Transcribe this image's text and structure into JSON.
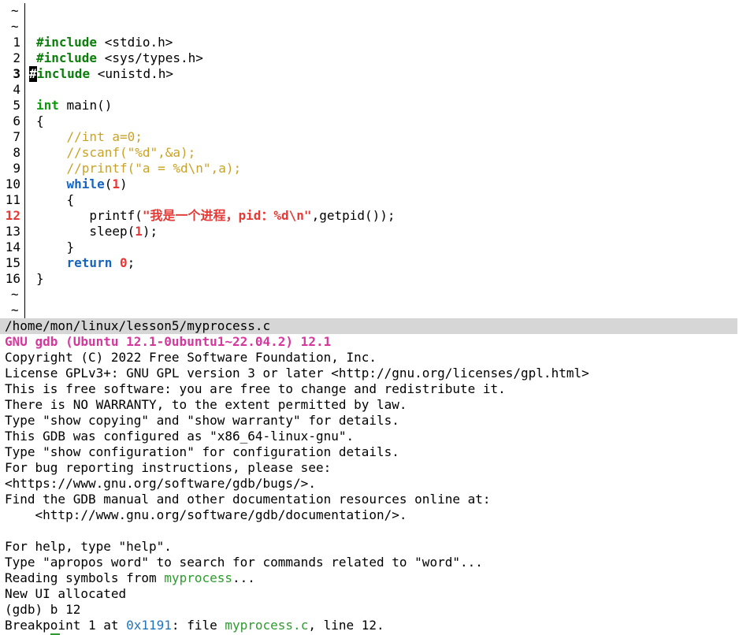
{
  "editor": {
    "empty_marker": "~",
    "lines": [
      {
        "num": "1",
        "parts": [
          [
            "#include",
            "kw-pre"
          ],
          [
            " <stdio.h>",
            ""
          ]
        ]
      },
      {
        "num": "2",
        "parts": [
          [
            "#include",
            "kw-pre"
          ],
          [
            " <sys/types.h>",
            ""
          ]
        ]
      },
      {
        "num": "3",
        "parts": [
          [
            "#include",
            "kw-pre"
          ],
          [
            " <unistd.h>",
            ""
          ]
        ],
        "current": true
      },
      {
        "num": "4",
        "parts": []
      },
      {
        "num": "5",
        "parts": [
          [
            "int",
            "kw-type"
          ],
          [
            " main()",
            ""
          ]
        ]
      },
      {
        "num": "6",
        "parts": [
          [
            "{",
            ""
          ]
        ]
      },
      {
        "num": "7",
        "parts": [
          [
            "    ",
            ""
          ],
          [
            "//int a=0;",
            "cmt"
          ]
        ]
      },
      {
        "num": "8",
        "parts": [
          [
            "    ",
            ""
          ],
          [
            "//scanf(\"%d\",&a);",
            "cmt"
          ]
        ]
      },
      {
        "num": "9",
        "parts": [
          [
            "    ",
            ""
          ],
          [
            "//printf(\"a = %d\\n\",a);",
            "cmt"
          ]
        ]
      },
      {
        "num": "10",
        "parts": [
          [
            "    ",
            ""
          ],
          [
            "while",
            "kw-ctl"
          ],
          [
            "(",
            ""
          ],
          [
            "1",
            "num"
          ],
          [
            ")",
            ""
          ]
        ]
      },
      {
        "num": "11",
        "parts": [
          [
            "    {",
            ""
          ]
        ]
      },
      {
        "num": "12",
        "parts": [
          [
            "       printf(",
            ""
          ],
          [
            "\"我是一个进程，pid：%d\\n\"",
            "str"
          ],
          [
            ",getpid());",
            ""
          ]
        ],
        "breakpoint": true
      },
      {
        "num": "13",
        "parts": [
          [
            "       sleep(",
            ""
          ],
          [
            "1",
            "num"
          ],
          [
            ");",
            ""
          ]
        ]
      },
      {
        "num": "14",
        "parts": [
          [
            "    }",
            ""
          ]
        ]
      },
      {
        "num": "15",
        "parts": [
          [
            "    ",
            ""
          ],
          [
            "return",
            "kw-ctl"
          ],
          [
            " ",
            ""
          ],
          [
            "0",
            "num"
          ],
          [
            ";",
            ""
          ]
        ]
      },
      {
        "num": "16",
        "parts": [
          [
            "}",
            ""
          ]
        ]
      }
    ]
  },
  "status_bar": {
    "file_path": "/home/mon/linux/lesson5/myprocess.c"
  },
  "gdb": {
    "lines": [
      [
        [
          "GNU gdb (Ubuntu 12.1-0ubuntu1~22.04.2) 12.1",
          "gdb-title"
        ]
      ],
      [
        [
          "Copyright (C) 2022 Free Software Foundation, Inc.",
          ""
        ]
      ],
      [
        [
          "License GPLv3+: GNU GPL version 3 or later <http://gnu.org/licenses/gpl.html>",
          ""
        ]
      ],
      [
        [
          "This is free software: you are free to change and redistribute it.",
          ""
        ]
      ],
      [
        [
          "There is NO WARRANTY, to the extent permitted by law.",
          ""
        ]
      ],
      [
        [
          "Type \"show copying\" and \"show warranty\" for details.",
          ""
        ]
      ],
      [
        [
          "This GDB was configured as \"x86_64-linux-gnu\".",
          ""
        ]
      ],
      [
        [
          "Type \"show configuration\" for configuration details.",
          ""
        ]
      ],
      [
        [
          "For bug reporting instructions, please see:",
          ""
        ]
      ],
      [
        [
          "<https://www.gnu.org/software/gdb/bugs/>.",
          ""
        ]
      ],
      [
        [
          "Find the GDB manual and other documentation resources online at:",
          ""
        ]
      ],
      [
        [
          "    <http://www.gnu.org/software/gdb/documentation/>.",
          ""
        ]
      ],
      [
        [
          "",
          ""
        ]
      ],
      [
        [
          "For help, type \"help\".",
          ""
        ]
      ],
      [
        [
          "Type \"apropos word\" to search for commands related to \"word\"...",
          ""
        ]
      ],
      [
        [
          "Reading symbols from ",
          ""
        ],
        [
          "myprocess",
          "green"
        ],
        [
          "...",
          ""
        ]
      ],
      [
        [
          "New UI allocated",
          ""
        ]
      ],
      [
        [
          "(gdb) b 12",
          ""
        ]
      ],
      [
        [
          "Breakpoint 1 at ",
          ""
        ],
        [
          "0x1191",
          "addr"
        ],
        [
          ": file ",
          ""
        ],
        [
          "myprocess.c",
          "green"
        ],
        [
          ", line 12.",
          ""
        ]
      ]
    ]
  }
}
